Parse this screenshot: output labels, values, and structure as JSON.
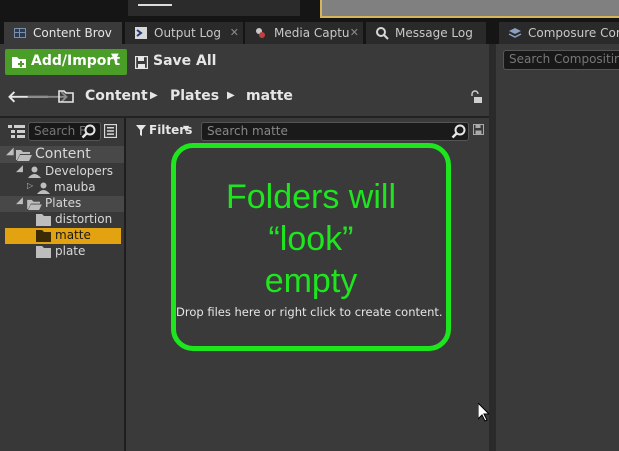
{
  "tabs": [
    {
      "label": "Content Brov",
      "icon": "content-browser-icon",
      "active": true
    },
    {
      "label": "Output Log",
      "icon": "output-log-icon",
      "active": false
    },
    {
      "label": "Media Captu",
      "icon": "media-capture-icon",
      "active": false
    },
    {
      "label": "Message Log",
      "icon": "message-log-icon",
      "active": false
    },
    {
      "label": "Composure Com",
      "icon": "composure-icon",
      "active": false
    }
  ],
  "toolbar": {
    "add_import_label": "Add/Import",
    "save_all_label": "Save All"
  },
  "breadcrumb": {
    "items": [
      "Content",
      "Plates",
      "matte"
    ]
  },
  "sidebar": {
    "search_placeholder": "Search F",
    "tree": [
      {
        "label": "Content"
      },
      {
        "label": "Developers"
      },
      {
        "label": "mauba"
      },
      {
        "label": "Plates"
      },
      {
        "label": "distortion"
      },
      {
        "label": "matte",
        "selected": true
      },
      {
        "label": "plate"
      }
    ]
  },
  "main": {
    "filters_label": "Filters",
    "search_placeholder": "Search matte",
    "empty_message": "Drop files here or right click to create content."
  },
  "annotation": {
    "line1": "Folders will",
    "line2": "“look”",
    "line3": "empty",
    "color": "#1ee61e"
  },
  "composure": {
    "search_placeholder": "Search Compositing"
  },
  "colors": {
    "accent_green": "#4a9e28",
    "selection": "#e3a20f"
  }
}
